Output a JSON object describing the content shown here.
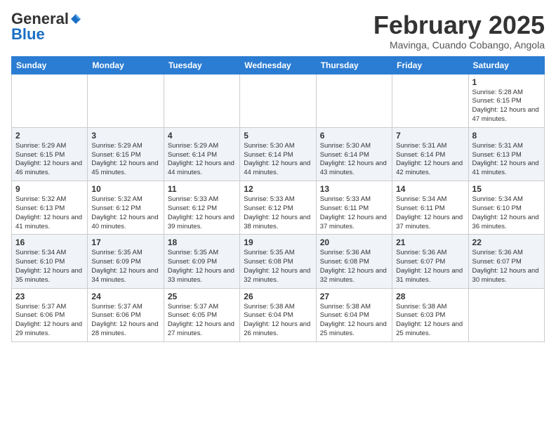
{
  "logo": {
    "general": "General",
    "blue": "Blue"
  },
  "header": {
    "title": "February 2025",
    "subtitle": "Mavinga, Cuando Cobango, Angola"
  },
  "weekdays": [
    "Sunday",
    "Monday",
    "Tuesday",
    "Wednesday",
    "Thursday",
    "Friday",
    "Saturday"
  ],
  "weeks": [
    [
      {
        "day": "",
        "info": ""
      },
      {
        "day": "",
        "info": ""
      },
      {
        "day": "",
        "info": ""
      },
      {
        "day": "",
        "info": ""
      },
      {
        "day": "",
        "info": ""
      },
      {
        "day": "",
        "info": ""
      },
      {
        "day": "1",
        "info": "Sunrise: 5:28 AM\nSunset: 6:15 PM\nDaylight: 12 hours and 47 minutes."
      }
    ],
    [
      {
        "day": "2",
        "info": "Sunrise: 5:29 AM\nSunset: 6:15 PM\nDaylight: 12 hours and 46 minutes."
      },
      {
        "day": "3",
        "info": "Sunrise: 5:29 AM\nSunset: 6:15 PM\nDaylight: 12 hours and 45 minutes."
      },
      {
        "day": "4",
        "info": "Sunrise: 5:29 AM\nSunset: 6:14 PM\nDaylight: 12 hours and 44 minutes."
      },
      {
        "day": "5",
        "info": "Sunrise: 5:30 AM\nSunset: 6:14 PM\nDaylight: 12 hours and 44 minutes."
      },
      {
        "day": "6",
        "info": "Sunrise: 5:30 AM\nSunset: 6:14 PM\nDaylight: 12 hours and 43 minutes."
      },
      {
        "day": "7",
        "info": "Sunrise: 5:31 AM\nSunset: 6:14 PM\nDaylight: 12 hours and 42 minutes."
      },
      {
        "day": "8",
        "info": "Sunrise: 5:31 AM\nSunset: 6:13 PM\nDaylight: 12 hours and 41 minutes."
      }
    ],
    [
      {
        "day": "9",
        "info": "Sunrise: 5:32 AM\nSunset: 6:13 PM\nDaylight: 12 hours and 41 minutes."
      },
      {
        "day": "10",
        "info": "Sunrise: 5:32 AM\nSunset: 6:12 PM\nDaylight: 12 hours and 40 minutes."
      },
      {
        "day": "11",
        "info": "Sunrise: 5:33 AM\nSunset: 6:12 PM\nDaylight: 12 hours and 39 minutes."
      },
      {
        "day": "12",
        "info": "Sunrise: 5:33 AM\nSunset: 6:12 PM\nDaylight: 12 hours and 38 minutes."
      },
      {
        "day": "13",
        "info": "Sunrise: 5:33 AM\nSunset: 6:11 PM\nDaylight: 12 hours and 37 minutes."
      },
      {
        "day": "14",
        "info": "Sunrise: 5:34 AM\nSunset: 6:11 PM\nDaylight: 12 hours and 37 minutes."
      },
      {
        "day": "15",
        "info": "Sunrise: 5:34 AM\nSunset: 6:10 PM\nDaylight: 12 hours and 36 minutes."
      }
    ],
    [
      {
        "day": "16",
        "info": "Sunrise: 5:34 AM\nSunset: 6:10 PM\nDaylight: 12 hours and 35 minutes."
      },
      {
        "day": "17",
        "info": "Sunrise: 5:35 AM\nSunset: 6:09 PM\nDaylight: 12 hours and 34 minutes."
      },
      {
        "day": "18",
        "info": "Sunrise: 5:35 AM\nSunset: 6:09 PM\nDaylight: 12 hours and 33 minutes."
      },
      {
        "day": "19",
        "info": "Sunrise: 5:35 AM\nSunset: 6:08 PM\nDaylight: 12 hours and 32 minutes."
      },
      {
        "day": "20",
        "info": "Sunrise: 5:36 AM\nSunset: 6:08 PM\nDaylight: 12 hours and 32 minutes."
      },
      {
        "day": "21",
        "info": "Sunrise: 5:36 AM\nSunset: 6:07 PM\nDaylight: 12 hours and 31 minutes."
      },
      {
        "day": "22",
        "info": "Sunrise: 5:36 AM\nSunset: 6:07 PM\nDaylight: 12 hours and 30 minutes."
      }
    ],
    [
      {
        "day": "23",
        "info": "Sunrise: 5:37 AM\nSunset: 6:06 PM\nDaylight: 12 hours and 29 minutes."
      },
      {
        "day": "24",
        "info": "Sunrise: 5:37 AM\nSunset: 6:06 PM\nDaylight: 12 hours and 28 minutes."
      },
      {
        "day": "25",
        "info": "Sunrise: 5:37 AM\nSunset: 6:05 PM\nDaylight: 12 hours and 27 minutes."
      },
      {
        "day": "26",
        "info": "Sunrise: 5:38 AM\nSunset: 6:04 PM\nDaylight: 12 hours and 26 minutes."
      },
      {
        "day": "27",
        "info": "Sunrise: 5:38 AM\nSunset: 6:04 PM\nDaylight: 12 hours and 25 minutes."
      },
      {
        "day": "28",
        "info": "Sunrise: 5:38 AM\nSunset: 6:03 PM\nDaylight: 12 hours and 25 minutes."
      },
      {
        "day": "",
        "info": ""
      }
    ]
  ]
}
